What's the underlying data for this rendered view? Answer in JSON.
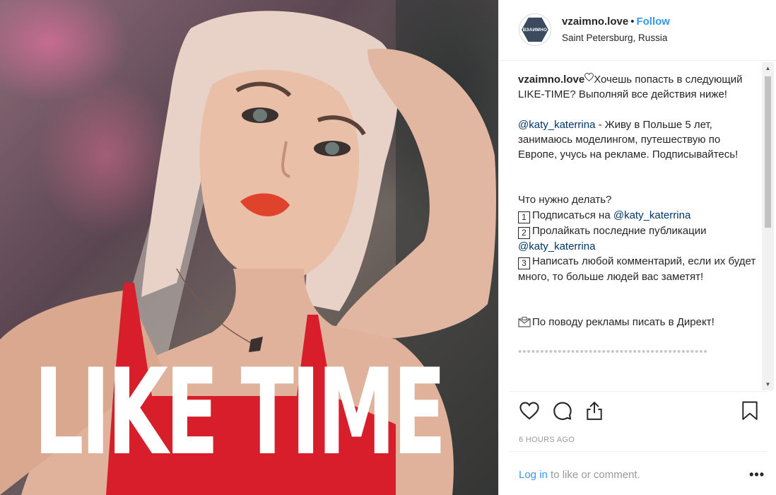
{
  "photo": {
    "overlay_text": "LIKE TIME"
  },
  "header": {
    "avatar_text": "ВЗАИМНО",
    "username": "vzaimno.love",
    "separator": "•",
    "follow_label": "Follow",
    "location": "Saint Petersburg, Russia"
  },
  "caption": {
    "author": "vzaimno.love",
    "intro": "Хочешь попасть в следующий LIKE-TIME? Выполняй все действия ниже!",
    "mention_1": "@katy_katerrina",
    "bio": " - Живу в Польше 5 лет, занимаюсь моделингом, путешествую по Европе, учусь на рекламе. Подписывайтесь!",
    "what_to_do": "Что нужно делать?",
    "step_1_num": "1",
    "step_1_text": "Подписаться на ",
    "step_1_mention": "@katy_katerrina",
    "step_2_num": "2",
    "step_2_text": "Пролайкать последние публикации",
    "step_2_mention": "@katy_katerrina",
    "step_3_num": "3",
    "step_3_text": "Написать любой комментарий, если их будет много, то больше людей вас заметят!",
    "ads_text": "По поводу рекламы писать в Директ!",
    "trailing": "•••••••••••••••••••••••••••••••••••••••••••"
  },
  "actions": {
    "like_icon": "heart-outline-icon",
    "comment_icon": "comment-bubble-icon",
    "share_icon": "share-upload-icon",
    "save_icon": "bookmark-icon",
    "timestamp": "6 HOURS AGO"
  },
  "footer": {
    "login_link": "Log in",
    "login_rest": " to like or comment.",
    "more": "•••"
  },
  "colors": {
    "link_blue": "#3897f0",
    "mention_blue": "#003569",
    "text": "#262626",
    "muted": "#999999"
  }
}
